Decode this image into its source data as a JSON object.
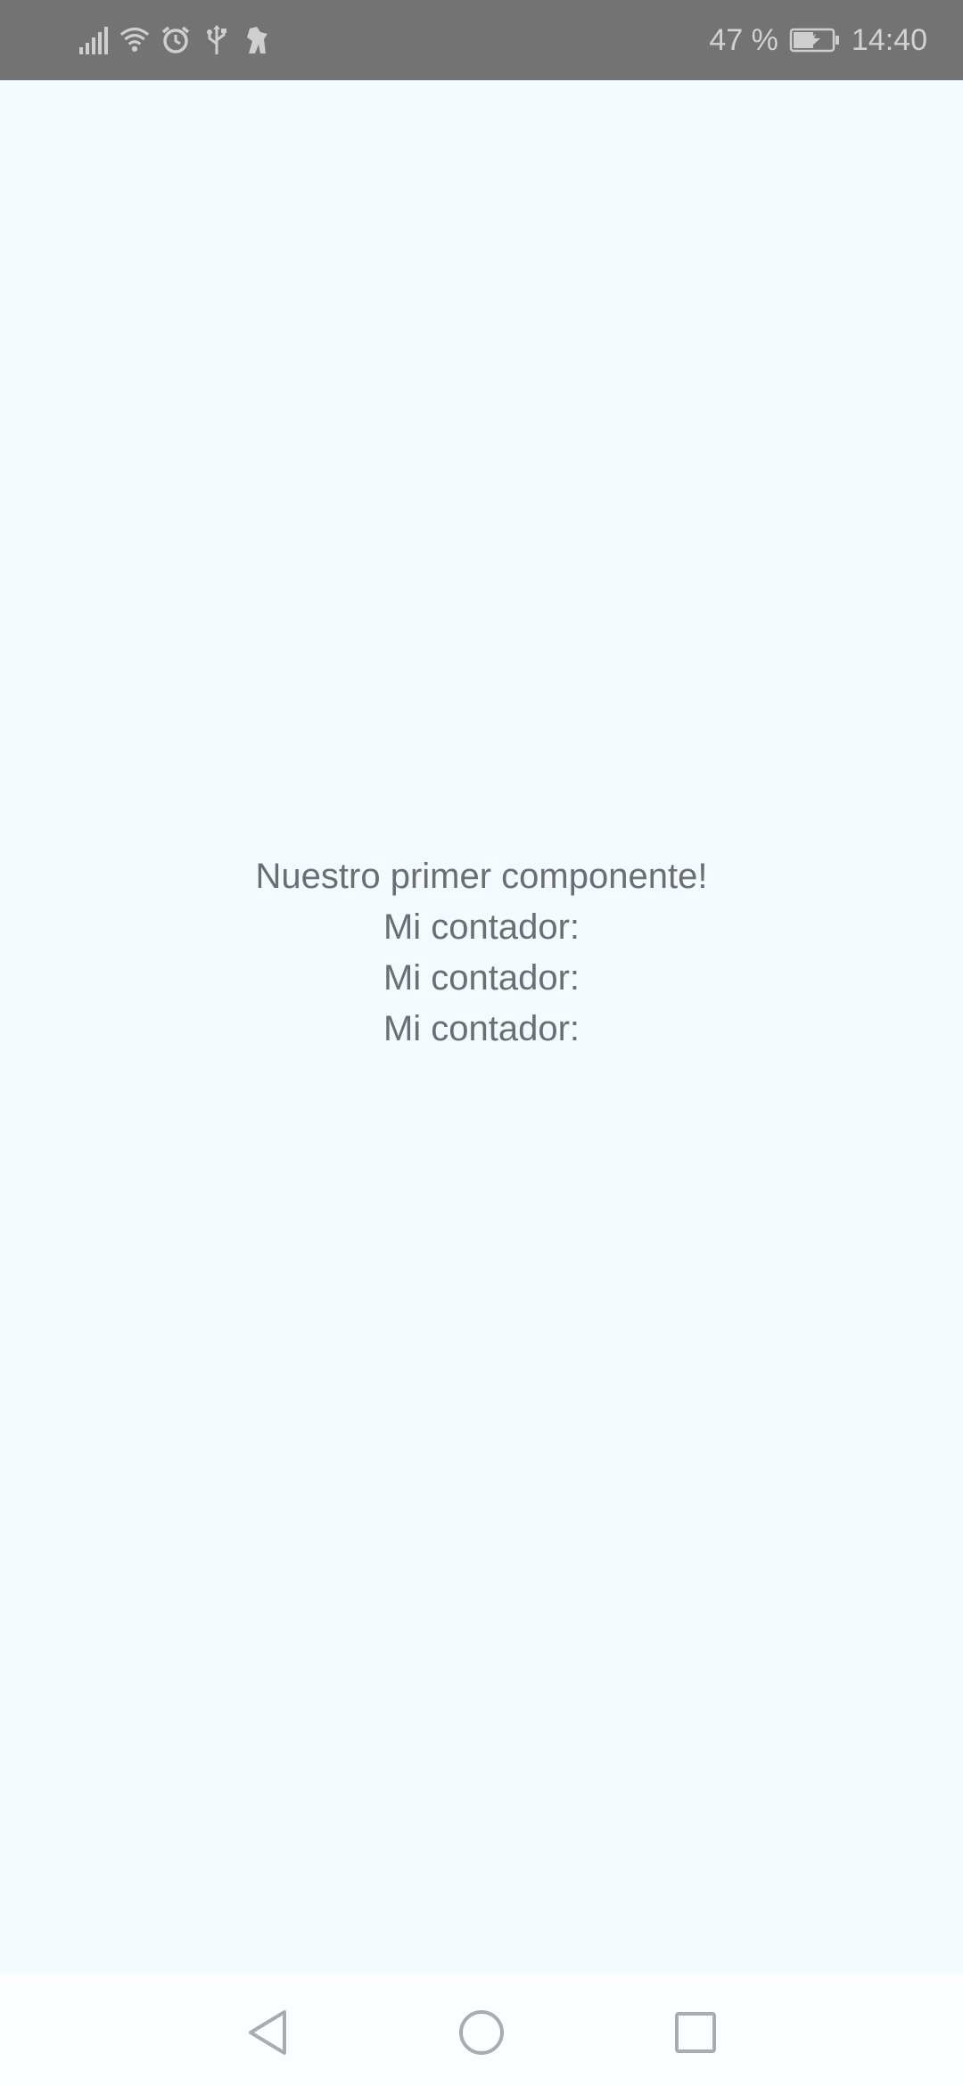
{
  "status_bar": {
    "battery_percent": "47 %",
    "time": "14:40",
    "icons": [
      "signal-icon",
      "wifi-icon",
      "alarm-icon",
      "usb-icon",
      "app-notification-icon",
      "battery-charging-icon"
    ]
  },
  "main": {
    "title": "Nuestro primer componente!",
    "counters": [
      "Mi contador:",
      "Mi contador:",
      "Mi contador:"
    ]
  },
  "nav_bar": {
    "buttons": [
      "back-icon",
      "home-icon",
      "recents-icon"
    ]
  },
  "colors": {
    "status_bar_bg": "#737373",
    "content_bg": "#f4fbfe",
    "text": "#6b6e72",
    "nav_icons": "#a9acaf"
  }
}
